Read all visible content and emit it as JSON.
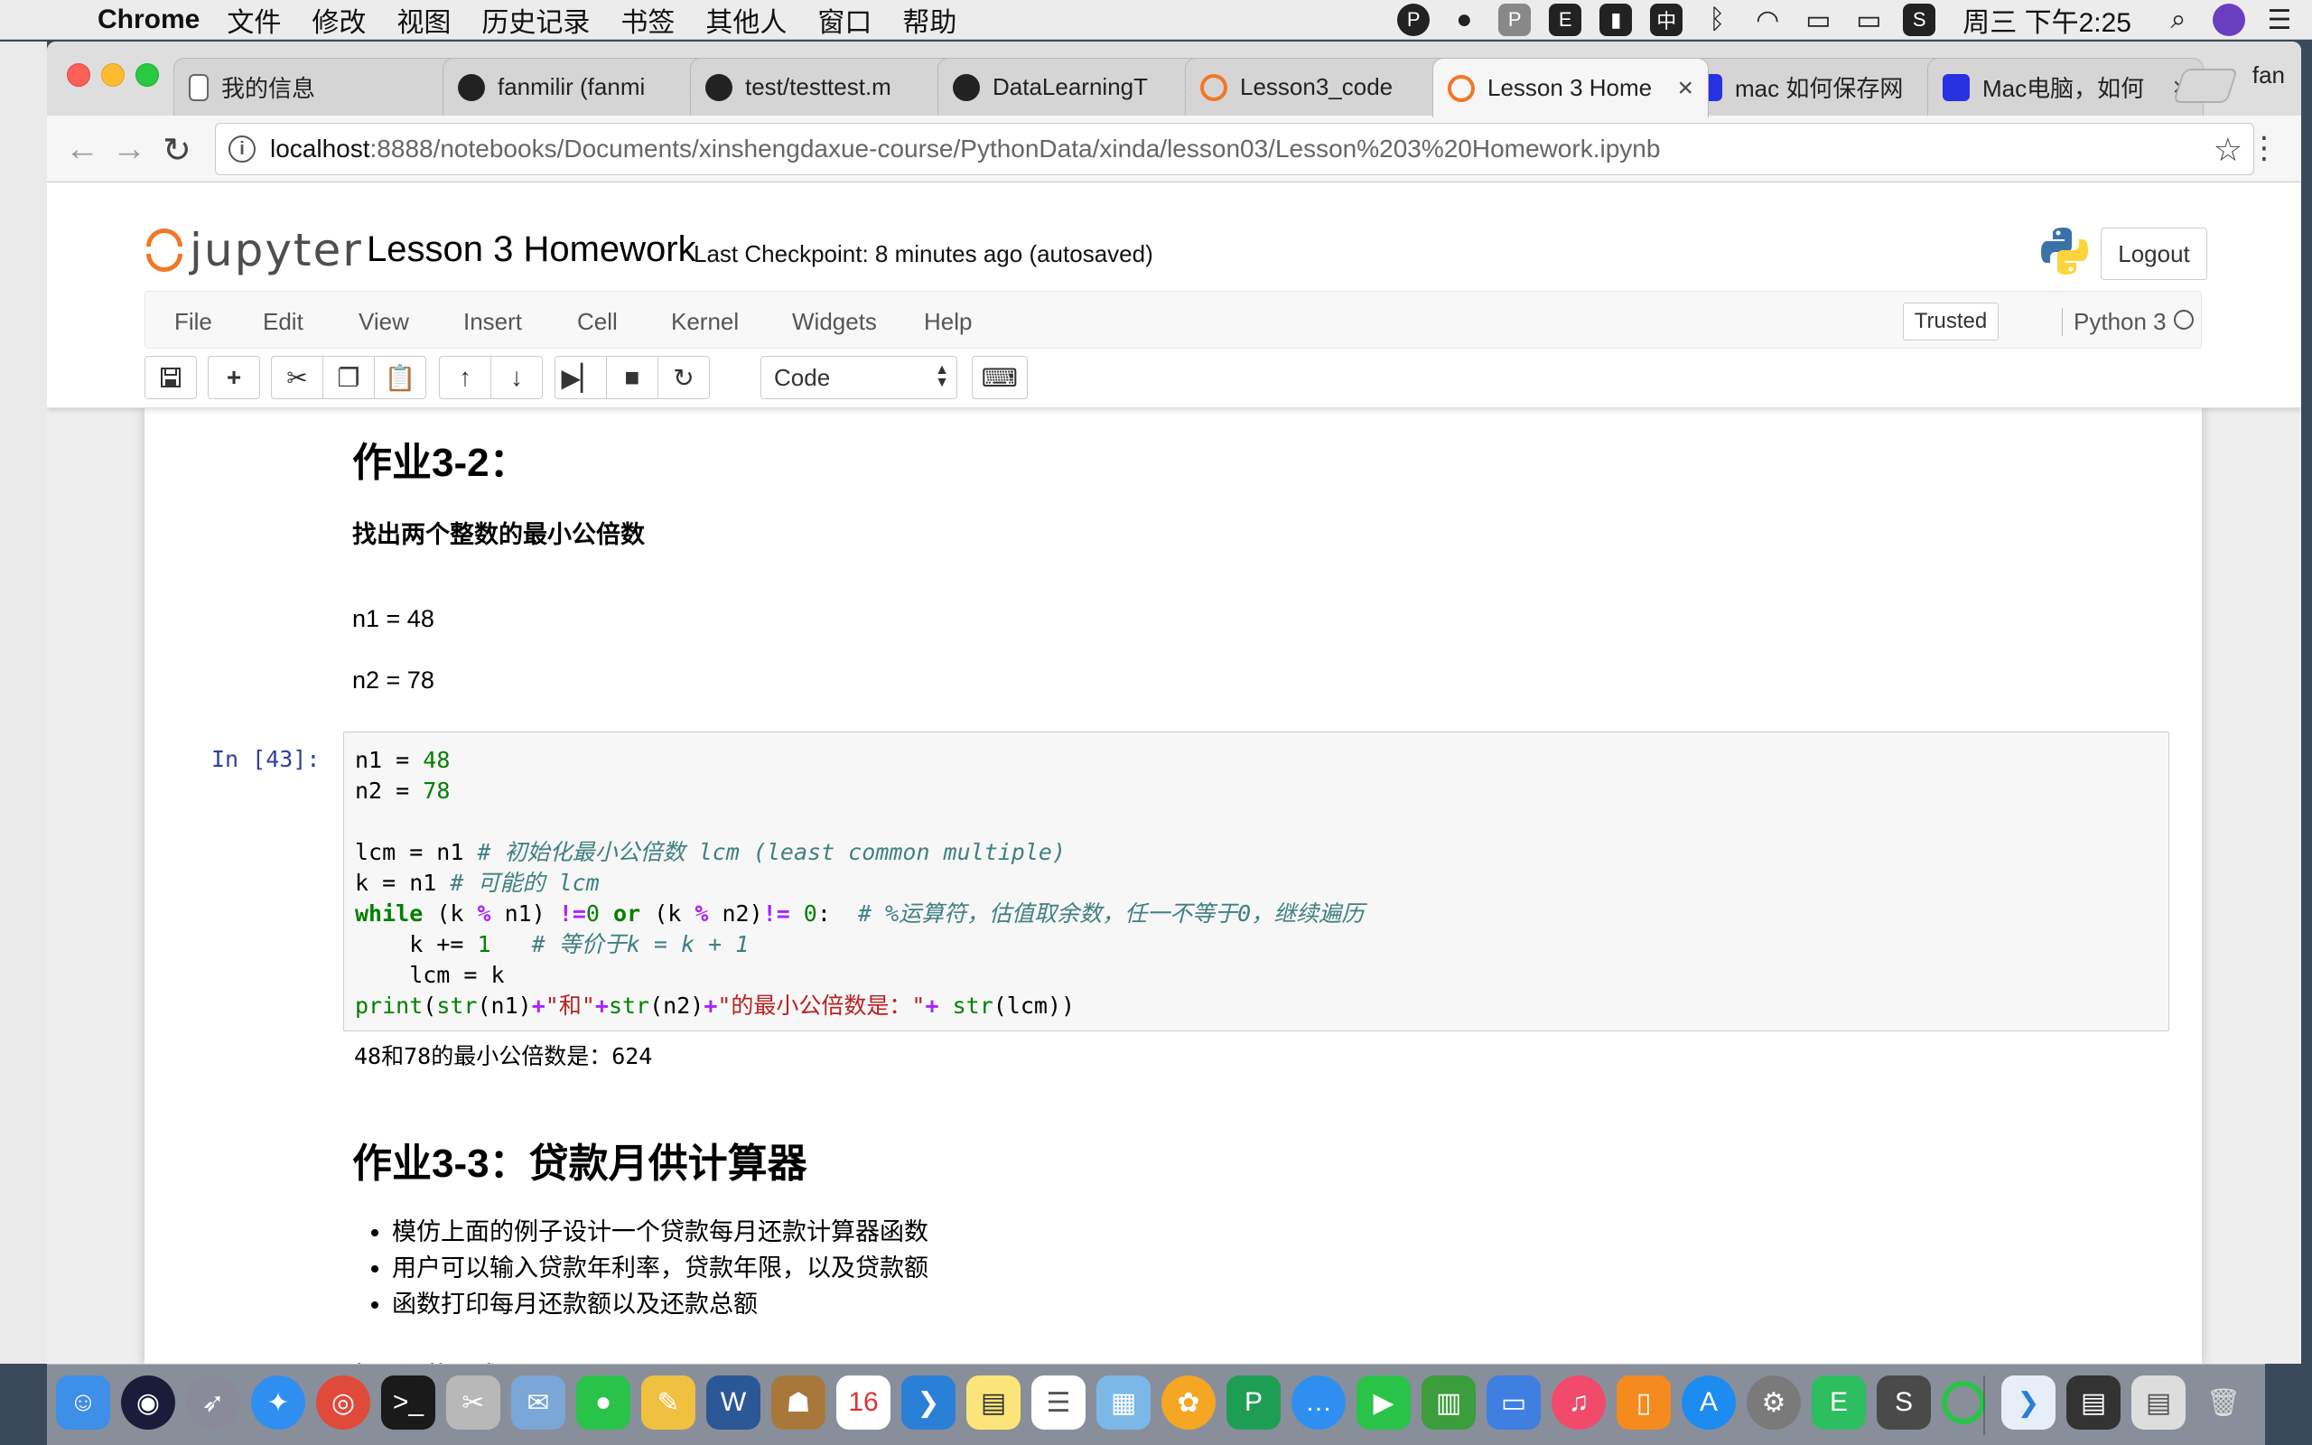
{
  "menubar": {
    "app_name": "Chrome",
    "items": [
      "文件",
      "修改",
      "视图",
      "历史记录",
      "书签",
      "其他人",
      "窗口",
      "帮助"
    ],
    "clock": "周三 下午2:25"
  },
  "tabs": [
    {
      "title": "我的信息",
      "icon": "document-icon"
    },
    {
      "title": "fanmilir (fanmi",
      "icon": "github-icon"
    },
    {
      "title": "test/testtest.m",
      "icon": "github-icon"
    },
    {
      "title": "DataLearningT",
      "icon": "github-icon"
    },
    {
      "title": "Lesson3_code",
      "icon": "jupyter-icon"
    },
    {
      "title": "Lesson 3 Home",
      "icon": "jupyter-icon"
    },
    {
      "title": "mac 如何保存网",
      "icon": "baidu-icon"
    },
    {
      "title": "Mac电脑，如何",
      "icon": "baidu-icon"
    }
  ],
  "profile_name": "fan",
  "address": {
    "host": "localhost",
    "path": ":8888/notebooks/Documents/xinshengdaxue-course/PythonData/xinda/lesson03/Lesson%203%20Homework.ipynb"
  },
  "jupyter": {
    "logo_text": "jupyter",
    "notebook_title": "Lesson 3 Homework",
    "checkpoint": "Last Checkpoint: 8 minutes ago (autosaved)",
    "logout_label": "Logout",
    "menu": [
      "File",
      "Edit",
      "View",
      "Insert",
      "Cell",
      "Kernel",
      "Widgets",
      "Help"
    ],
    "trusted_label": "Trusted",
    "kernel_name": "Python 3",
    "cell_type": "Code"
  },
  "notebook": {
    "h_3_2": "作业3-2：",
    "task_3_2": "找出两个整数的最小公倍数",
    "n1_line": "n1 = 48",
    "n2_line": "n2 = 78",
    "prompt": "In [43]:",
    "output": "48和78的最小公倍数是：624",
    "h_3_3": "作业3-3：贷款月供计算器",
    "bullets": [
      "模仿上面的例子设计一个贷款每月还款计算器函数",
      "用户可以输入贷款年利率，贷款年限，以及贷款额",
      "函数打印每月还款额以及还款总额"
    ],
    "formula_heading": "每月还款公式："
  },
  "code": {
    "l1_a": "n1 = ",
    "l1_num": "48",
    "l2_a": "n2 = ",
    "l2_num": "78",
    "l4_a": "lcm = n1 ",
    "l4_cm": "# 初始化最小公倍数 lcm (least common multiple)",
    "l5_a": "k = n1 ",
    "l5_cm": "# 可能的 lcm",
    "l6_kw": "while",
    "l6_a": " (k ",
    "l6_op1": "%",
    "l6_b": " n1) ",
    "l6_op2": "!=",
    "l6_num1": "0",
    "l6_kw2": " or",
    "l6_c": " (k ",
    "l6_op3": "%",
    "l6_d": " n2)",
    "l6_op4": "!=",
    "l6_num2": " 0",
    "l6_e": ":  ",
    "l6_cm": "# %运算符，估值取余数，任一不等于0，继续遍历",
    "l7_a": "    k += ",
    "l7_num": "1",
    "l7_cm": "   # 等价于k = k + 1",
    "l8_a": "    lcm = k",
    "l9_bi": "print",
    "l9_a": "(",
    "l9_bi2": "str",
    "l9_b": "(n1)",
    "l9_op1": "+",
    "l9_st1": "\"和\"",
    "l9_op2": "+",
    "l9_bi3": "str",
    "l9_c": "(n2)",
    "l9_op3": "+",
    "l9_st2": "\"的最小公倍数是：\"",
    "l9_op4": "+ ",
    "l9_bi4": "str",
    "l9_d": "(lcm))"
  }
}
